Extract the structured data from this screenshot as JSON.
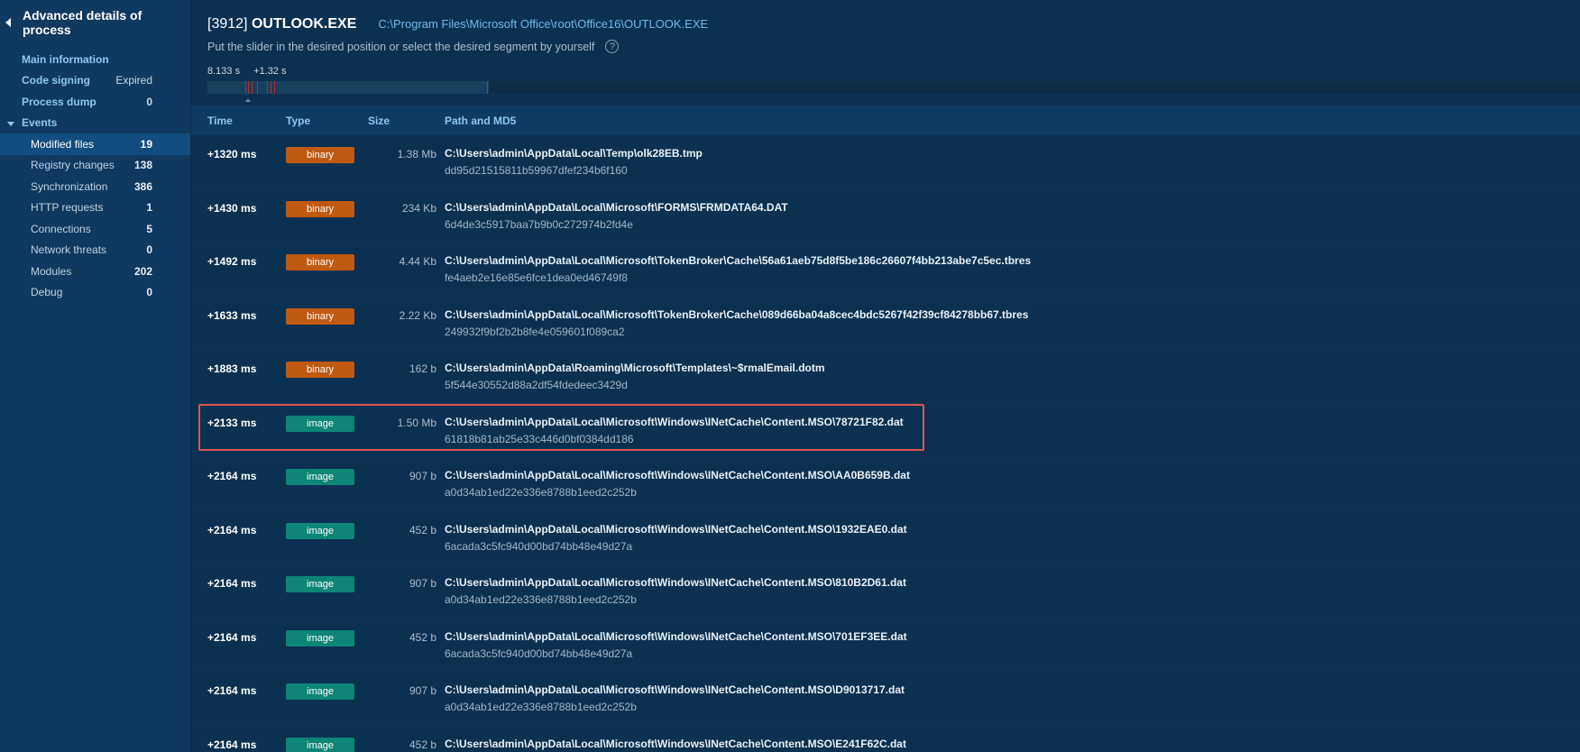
{
  "sidebar": {
    "title": "Advanced details of process",
    "items": [
      {
        "label": "Main information",
        "value": ""
      },
      {
        "label": "Code signing",
        "value": "Expired"
      },
      {
        "label": "Process dump",
        "value": "0"
      }
    ],
    "events_label": "Events",
    "events": [
      {
        "label": "Modified files",
        "value": "19"
      },
      {
        "label": "Registry changes",
        "value": "138"
      },
      {
        "label": "Synchronization",
        "value": "386"
      },
      {
        "label": "HTTP requests",
        "value": "1"
      },
      {
        "label": "Connections",
        "value": "5"
      },
      {
        "label": "Network threats",
        "value": "0"
      },
      {
        "label": "Modules",
        "value": "202"
      },
      {
        "label": "Debug",
        "value": "0"
      }
    ]
  },
  "header": {
    "pid": "[3912]",
    "process": "OUTLOOK.EXE",
    "path": "C:\\Program Files\\Microsoft Office\\root\\Office16\\OUTLOOK.EXE",
    "hint": "Put the slider in the desired position or select the desired segment by yourself",
    "help_glyph": "?"
  },
  "timeline": {
    "start": "8.133 s",
    "offset": "+1.32 s"
  },
  "table": {
    "columns": {
      "time": "Time",
      "type": "Type",
      "size": "Size",
      "path": "Path and MD5"
    },
    "rows": [
      {
        "time": "+1320 ms",
        "type": "binary",
        "size": "1.38 Mb",
        "path": "C:\\Users\\admin\\AppData\\Local\\Temp\\olk28EB.tmp",
        "md5": "dd95d21515811b59967dfef234b6f160"
      },
      {
        "time": "+1430 ms",
        "type": "binary",
        "size": "234 Kb",
        "path": "C:\\Users\\admin\\AppData\\Local\\Microsoft\\FORMS\\FRMDATA64.DAT",
        "md5": "6d4de3c5917baa7b9b0c272974b2fd4e"
      },
      {
        "time": "+1492 ms",
        "type": "binary",
        "size": "4.44 Kb",
        "path": "C:\\Users\\admin\\AppData\\Local\\Microsoft\\TokenBroker\\Cache\\56a61aeb75d8f5be186c26607f4bb213abe7c5ec.tbres",
        "md5": "fe4aeb2e16e85e6fce1dea0ed46749f8"
      },
      {
        "time": "+1633 ms",
        "type": "binary",
        "size": "2.22 Kb",
        "path": "C:\\Users\\admin\\AppData\\Local\\Microsoft\\TokenBroker\\Cache\\089d66ba04a8cec4bdc5267f42f39cf84278bb67.tbres",
        "md5": "249932f9bf2b2b8fe4e059601f089ca2"
      },
      {
        "time": "+1883 ms",
        "type": "binary",
        "size": "162 b",
        "path": "C:\\Users\\admin\\AppData\\Roaming\\Microsoft\\Templates\\~$rmalEmail.dotm",
        "md5": "5f544e30552d88a2df54fdedeec3429d"
      },
      {
        "time": "+2133 ms",
        "type": "image",
        "size": "1.50 Mb",
        "path": "C:\\Users\\admin\\AppData\\Local\\Microsoft\\Windows\\INetCache\\Content.MSO\\78721F82.dat",
        "md5": "61818b81ab25e33c446d0bf0384dd186"
      },
      {
        "time": "+2164 ms",
        "type": "image",
        "size": "907 b",
        "path": "C:\\Users\\admin\\AppData\\Local\\Microsoft\\Windows\\INetCache\\Content.MSO\\AA0B659B.dat",
        "md5": "a0d34ab1ed22e336e8788b1eed2c252b"
      },
      {
        "time": "+2164 ms",
        "type": "image",
        "size": "452 b",
        "path": "C:\\Users\\admin\\AppData\\Local\\Microsoft\\Windows\\INetCache\\Content.MSO\\1932EAE0.dat",
        "md5": "6acada3c5fc940d00bd74bb48e49d27a"
      },
      {
        "time": "+2164 ms",
        "type": "image",
        "size": "907 b",
        "path": "C:\\Users\\admin\\AppData\\Local\\Microsoft\\Windows\\INetCache\\Content.MSO\\810B2D61.dat",
        "md5": "a0d34ab1ed22e336e8788b1eed2c252b"
      },
      {
        "time": "+2164 ms",
        "type": "image",
        "size": "452 b",
        "path": "C:\\Users\\admin\\AppData\\Local\\Microsoft\\Windows\\INetCache\\Content.MSO\\701EF3EE.dat",
        "md5": "6acada3c5fc940d00bd74bb48e49d27a"
      },
      {
        "time": "+2164 ms",
        "type": "image",
        "size": "907 b",
        "path": "C:\\Users\\admin\\AppData\\Local\\Microsoft\\Windows\\INetCache\\Content.MSO\\D9013717.dat",
        "md5": "a0d34ab1ed22e336e8788b1eed2c252b"
      },
      {
        "time": "+2164 ms",
        "type": "image",
        "size": "452 b",
        "path": "C:\\Users\\admin\\AppData\\Local\\Microsoft\\Windows\\INetCache\\Content.MSO\\E241F62C.dat",
        "md5": ""
      }
    ]
  },
  "colors": {
    "binary_badge": "#c05a12",
    "image_badge": "#0e8575",
    "highlight": "#e05555"
  }
}
